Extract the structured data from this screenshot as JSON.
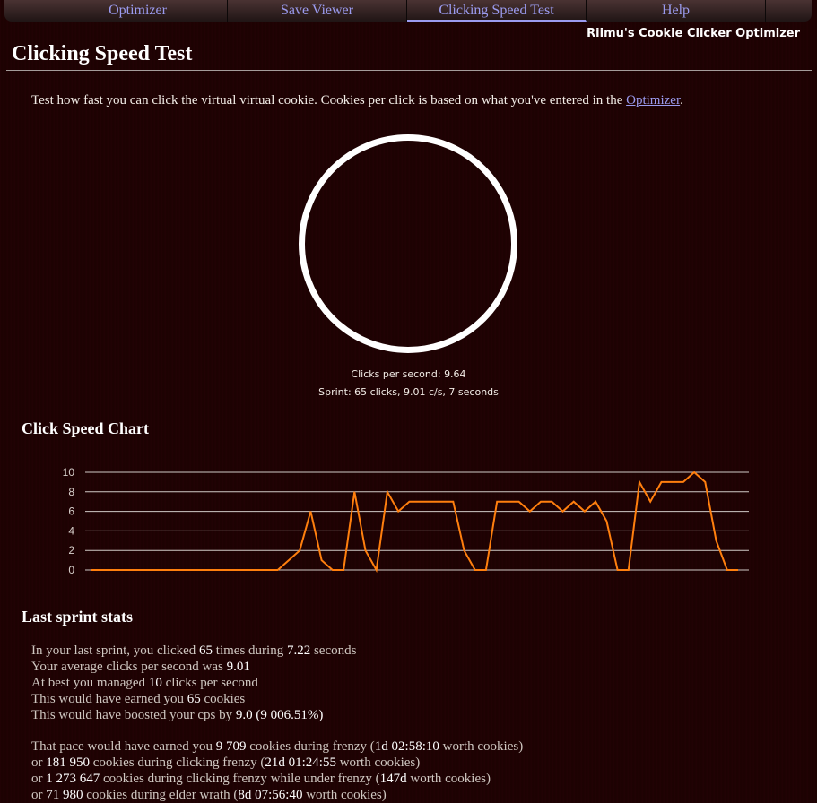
{
  "nav": {
    "items": [
      {
        "label": "Optimizer",
        "active": false
      },
      {
        "label": "Save Viewer",
        "active": false
      },
      {
        "label": "Clicking Speed Test",
        "active": true
      },
      {
        "label": "Help",
        "active": false
      }
    ]
  },
  "brand": "Riimu's Cookie Clicker Optimizer",
  "page_title": "Clicking Speed Test",
  "intro": {
    "text": "Test how fast you can click the virtual virtual cookie. Cookies per click is based on what you've entered in the ",
    "link": "Optimizer",
    "suffix": "."
  },
  "cookie": {
    "icon": "cookie-circle"
  },
  "live": {
    "cps": "Clicks per second: 9.64",
    "sprint": "Sprint: 65 clicks, 9.01 c/s, 7 seconds"
  },
  "chart_section_title": "Click Speed Chart",
  "chart_data": {
    "type": "line",
    "title": "Click Speed Chart",
    "xlabel": "",
    "ylabel": "",
    "ylim": [
      0,
      10
    ],
    "yticks": [
      "0",
      "2",
      "4",
      "6",
      "8",
      "10"
    ],
    "grid": true,
    "legend": "none",
    "series": [
      {
        "name": "clicks per second",
        "color": "#ff7f0e",
        "values": [
          0,
          0,
          0,
          0,
          0,
          0,
          0,
          0,
          0,
          0,
          0,
          0,
          0,
          0,
          0,
          0,
          0,
          0,
          1,
          2,
          6,
          1,
          0,
          0,
          8,
          2,
          0,
          8,
          6,
          7,
          7,
          7,
          7,
          7,
          2,
          0,
          0,
          7,
          7,
          7,
          6,
          7,
          7,
          6,
          7,
          6,
          7,
          5,
          0,
          0,
          9,
          7,
          9,
          9,
          9,
          10,
          9,
          3,
          0,
          0
        ]
      }
    ]
  },
  "stats_title": "Last sprint stats",
  "stats": {
    "l1": {
      "a": "In your last sprint, you clicked ",
      "b": "65",
      "c": " times during ",
      "d": "7.22",
      "e": " seconds"
    },
    "l2": {
      "a": "Your average clicks per second was ",
      "b": "9.01"
    },
    "l3": {
      "a": "At best you managed ",
      "b": "10",
      "c": " clicks per second"
    },
    "l4": {
      "a": "This would have earned you ",
      "b": "65",
      "c": " cookies"
    },
    "l5": {
      "a": "This would have boosted your cps by ",
      "b": "9.0 (9 006.51%)"
    },
    "l6": {
      "a": "That pace would have earned you ",
      "b": "9 709",
      "c": " cookies during frenzy (",
      "d": "1d 02:58:10",
      "e": " worth cookies)"
    },
    "l7": {
      "a": "or ",
      "b": "181 950",
      "c": " cookies during clicking frenzy (",
      "d": "21d 01:24:55",
      "e": " worth cookies)"
    },
    "l8": {
      "a": "or ",
      "b": "1 273 647",
      "c": " cookies during clicking frenzy while under frenzy (",
      "d": "147d",
      "e": " worth cookies)"
    },
    "l9": {
      "a": "or ",
      "b": "71 980",
      "c": " cookies during elder wrath (",
      "d": "8d 07:56:40",
      "e": " worth cookies)"
    }
  }
}
